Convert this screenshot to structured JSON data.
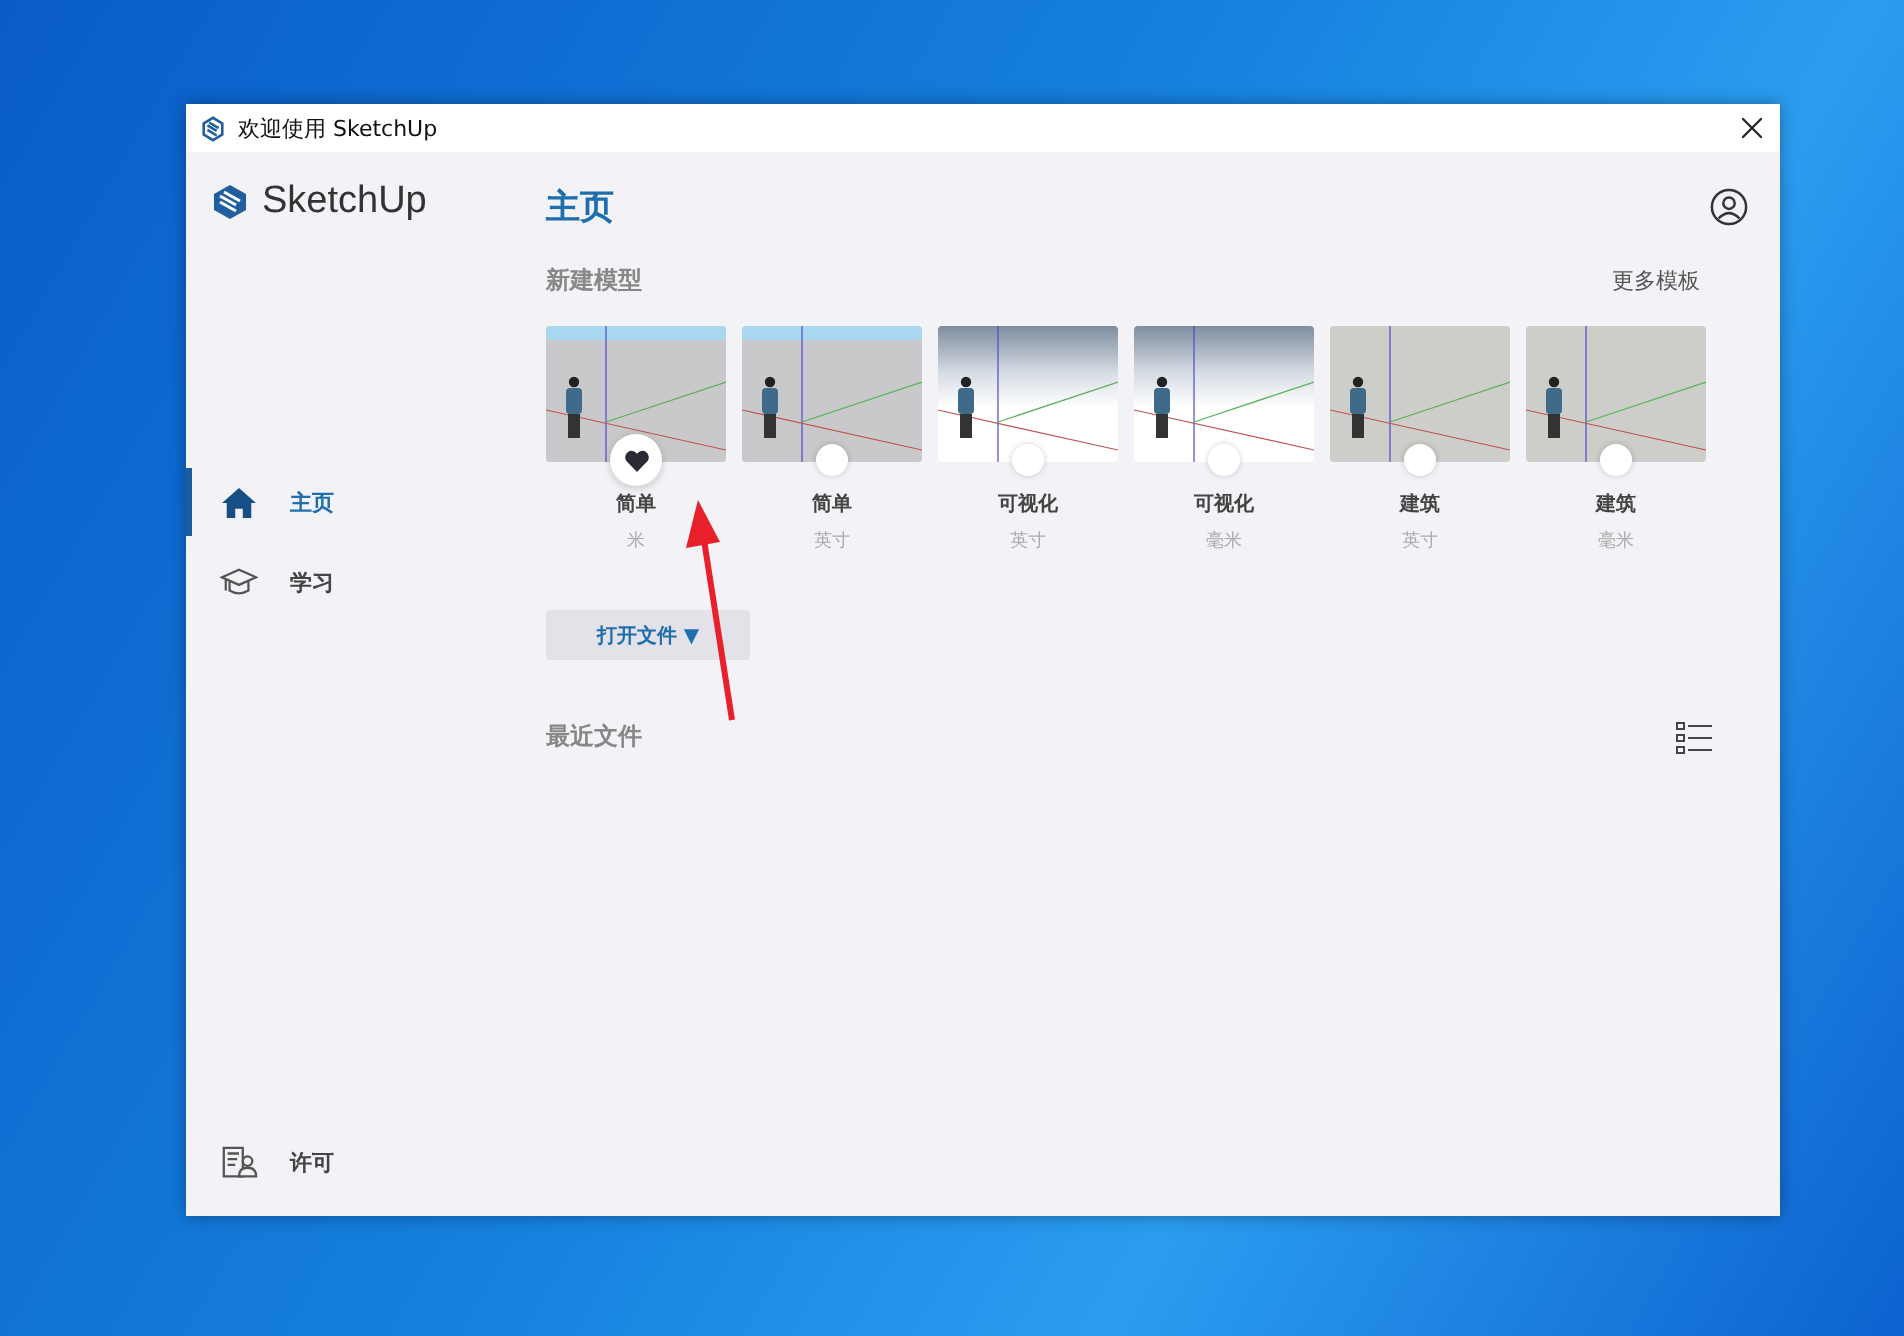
{
  "window": {
    "title": "欢迎使用 SketchUp"
  },
  "sidebar": {
    "logo": "SketchUp",
    "items": [
      {
        "kind": "home",
        "label": "主页",
        "selected": true
      },
      {
        "kind": "learn",
        "label": "学习",
        "selected": false
      }
    ],
    "footer": {
      "kind": "license",
      "label": "许可"
    }
  },
  "page": {
    "title": "主页"
  },
  "new_model": {
    "heading": "新建模型",
    "more_link": "更多模板",
    "templates": [
      {
        "kind": "sky",
        "name": "简单",
        "unit": "米",
        "favorite": true
      },
      {
        "kind": "sky",
        "name": "简单",
        "unit": "英寸",
        "favorite": false
      },
      {
        "kind": "clouds",
        "name": "可视化",
        "unit": "英寸",
        "favorite": false
      },
      {
        "kind": "clouds",
        "name": "可视化",
        "unit": "毫米",
        "favorite": false
      },
      {
        "kind": "plain",
        "name": "建筑",
        "unit": "英寸",
        "favorite": false
      },
      {
        "kind": "plain",
        "name": "建筑",
        "unit": "毫米",
        "favorite": false
      }
    ]
  },
  "open_button": {
    "label": "打开文件 ▼"
  },
  "recent": {
    "heading": "最近文件"
  }
}
